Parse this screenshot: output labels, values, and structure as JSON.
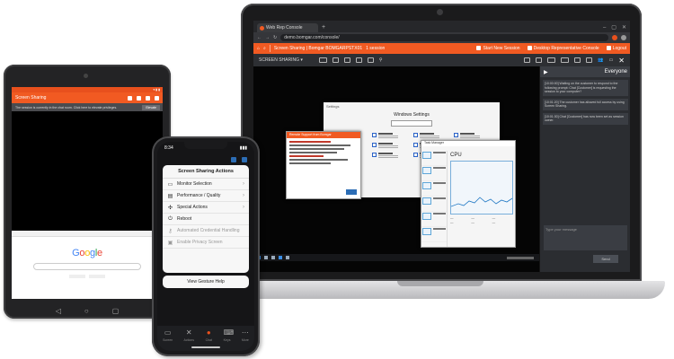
{
  "laptop": {
    "browser": {
      "tab_title": "Web Rep Console",
      "url": "demo.bomgar.com/console/",
      "url_domain": "demo.bomgar.com"
    },
    "app_bar": {
      "session_text": "Screen Sharing | Bomgar BOMGARPSTX01",
      "session_id": "1 session",
      "right_link_1": "Start New Session",
      "right_link_2": "Desktop Representative Console",
      "logout": "Logout"
    },
    "toolbar": {
      "screen_sharing_label": "SCREEN SHARING"
    },
    "remote": {
      "settings_window_title": "Settings",
      "settings_heading": "Windows Settings",
      "task_manager_title": "Task Manager",
      "cpu_label": "CPU",
      "chat_window_title": "Remote Support from Bomgar"
    },
    "chat": {
      "title": "Everyone",
      "messages": [
        "[10:00:00] Waiting on the customer to respond to the following prompt: Chat [Customer] is requesting the session to your computer?",
        "[10:01:20] The customer has allowed full access by using Screen Sharing.",
        "[10:01:30] Chat [Customer] has now been set as session owner."
      ],
      "input_placeholder": "Type your message",
      "send_label": "Send"
    }
  },
  "tablet": {
    "title": "Screen Sharing",
    "banner_text": "The session is currently in the chat room. Click here to elevate privileges.",
    "banner_button": "Elevate",
    "google_logo": [
      "G",
      "o",
      "o",
      "g",
      "l",
      "e"
    ]
  },
  "phone": {
    "time": "8:34",
    "sheet_title": "Screen Sharing Actions",
    "actions": [
      {
        "label": "Monitor Selection",
        "icon": "monitor-icon",
        "enabled": true
      },
      {
        "label": "Performance / Quality",
        "icon": "performance-icon",
        "enabled": true
      },
      {
        "label": "Special Actions",
        "icon": "special-actions-icon",
        "enabled": true
      },
      {
        "label": "Reboot",
        "icon": "reboot-icon",
        "enabled": true
      },
      {
        "label": "Automated Credential Handling",
        "icon": "key-icon",
        "enabled": false
      },
      {
        "label": "Enable Privacy Screen",
        "icon": "privacy-icon",
        "enabled": false
      }
    ],
    "footer_action": "View Gesture Help",
    "tabs": [
      {
        "label": "Screen",
        "icon": "screen-icon"
      },
      {
        "label": "Actions",
        "icon": "tools-icon"
      },
      {
        "label": "Chat",
        "icon": "chat-icon"
      },
      {
        "label": "Keys",
        "icon": "keyboard-icon"
      },
      {
        "label": "More",
        "icon": "more-icon"
      }
    ]
  },
  "colors": {
    "brand_orange": "#f15a22",
    "link_blue": "#2c6db5"
  }
}
